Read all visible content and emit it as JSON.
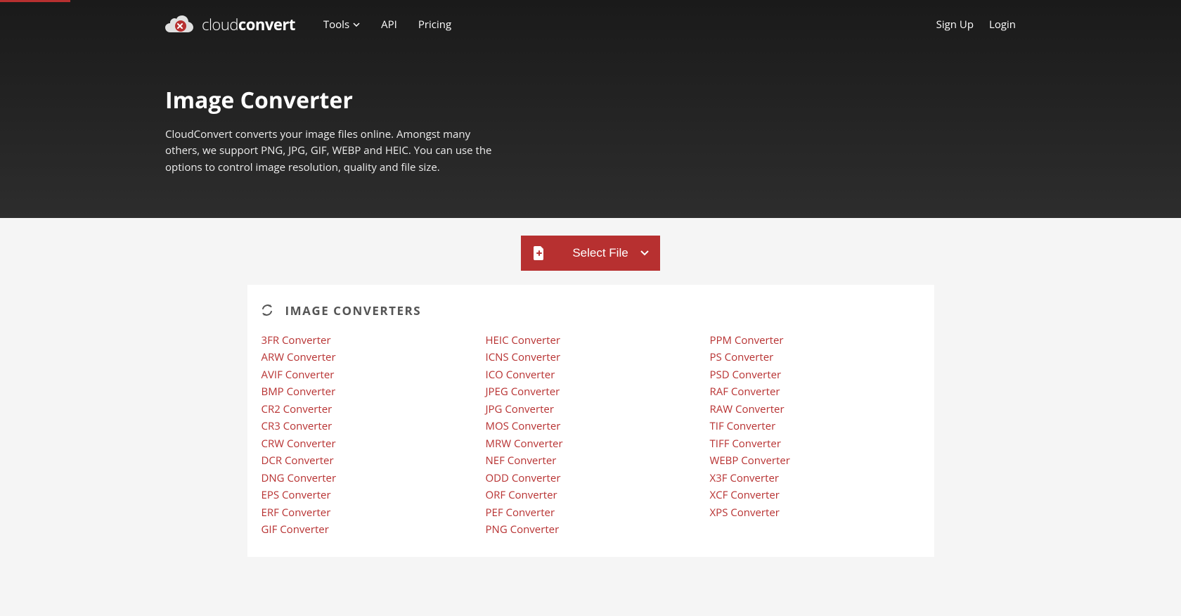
{
  "brand": {
    "name_light": "cloud",
    "name_bold": "convert"
  },
  "nav": {
    "tools": "Tools",
    "api": "API",
    "pricing": "Pricing",
    "signup": "Sign Up",
    "login": "Login"
  },
  "hero": {
    "title": "Image Converter",
    "desc": "CloudConvert converts your image files online. Amongst many others, we support PNG, JPG, GIF, WEBP and HEIC. You can use the options to control image resolution, quality and file size."
  },
  "select_file": {
    "label": "Select File"
  },
  "card": {
    "title": "IMAGE CONVERTERS",
    "columns": [
      [
        "3FR Converter",
        "ARW Converter",
        "AVIF Converter",
        "BMP Converter",
        "CR2 Converter",
        "CR3 Converter",
        "CRW Converter",
        "DCR Converter",
        "DNG Converter",
        "EPS Converter",
        "ERF Converter",
        "GIF Converter"
      ],
      [
        "HEIC Converter",
        "ICNS Converter",
        "ICO Converter",
        "JPEG Converter",
        "JPG Converter",
        "MOS Converter",
        "MRW Converter",
        "NEF Converter",
        "ODD Converter",
        "ORF Converter",
        "PEF Converter",
        "PNG Converter"
      ],
      [
        "PPM Converter",
        "PS Converter",
        "PSD Converter",
        "RAF Converter",
        "RAW Converter",
        "TIF Converter",
        "TIFF Converter",
        "WEBP Converter",
        "X3F Converter",
        "XCF Converter",
        "XPS Converter"
      ]
    ]
  }
}
